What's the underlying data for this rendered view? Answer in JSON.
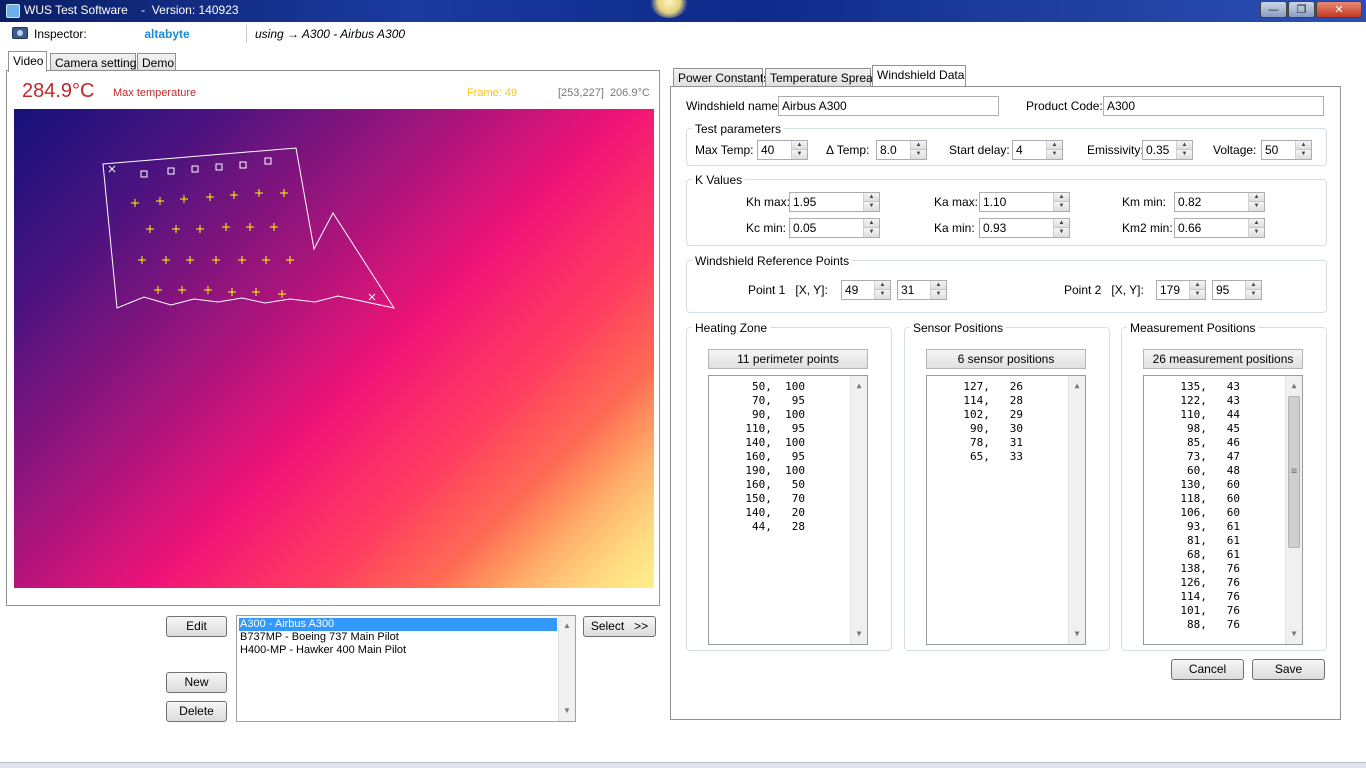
{
  "window": {
    "title": "WUS Test Software    -  Version: 140923",
    "minimize_glyph": "—",
    "maximize_glyph": "❐",
    "close_glyph": "✕"
  },
  "inspector": {
    "label": "Inspector:",
    "name": "altabyte",
    "using": "using → A300 - Airbus A300"
  },
  "left_tabs": [
    "Video",
    "Camera settings",
    "Demo"
  ],
  "video": {
    "max_temp": "284.9°C",
    "max_temp_label": "Max temperature",
    "frame": "Frame: 49",
    "cursor_coord": "[253,227]",
    "cursor_temp": "206.9°C"
  },
  "buttons": {
    "edit": "Edit",
    "new": "New",
    "delete": "Delete",
    "select": "Select   >>",
    "cancel": "Cancel",
    "save": "Save"
  },
  "windshield_list": [
    "A300 - Airbus A300",
    "B737MP - Boeing 737 Main Pilot",
    "H400-MP - Hawker 400 Main Pilot"
  ],
  "right_tabs": [
    "Power Constants",
    "Temperature Spread",
    "Windshield Data"
  ],
  "windshield": {
    "name_label": "Windshield name:",
    "name_value": "Airbus A300",
    "product_label": "Product Code:",
    "product_value": "A300"
  },
  "test_parameters": {
    "title": "Test parameters",
    "max_temp_label": "Max Temp:",
    "max_temp": "40",
    "delta_temp_label": "Δ Temp:",
    "delta_temp": "8.0",
    "start_delay_label": "Start delay:",
    "start_delay": "4",
    "emissivity_label": "Emissivity:",
    "emissivity": "0.35",
    "voltage_label": "Voltage:",
    "voltage": "50"
  },
  "k_values": {
    "title": "K Values",
    "kh_max_label": "Kh max:",
    "kh_max": "1.95",
    "ka_max_label": "Ka max:",
    "ka_max": "1.10",
    "km_min_label": "Km min:",
    "km_min": "0.82",
    "kc_min_label": "Kc min:",
    "kc_min": "0.05",
    "ka_min_label": "Ka min:",
    "ka_min": "0.93",
    "km2_min_label": "Km2 min:",
    "km2_min": "0.66"
  },
  "reference_points": {
    "title": "Windshield Reference Points",
    "point1_label": "Point 1   [X, Y]:",
    "point1_x": "49",
    "point1_y": "31",
    "point2_label": "Point 2   [X, Y]:",
    "point2_x": "179",
    "point2_y": "95"
  },
  "heating_zone": {
    "title": "Heating Zone",
    "header": "11 perimeter points",
    "points": [
      "50,  100",
      "70,   95",
      "90,  100",
      "110,   95",
      "140,  100",
      "160,   95",
      "190,  100",
      "160,   50",
      "150,   70",
      "140,   20",
      "44,   28"
    ]
  },
  "sensor_positions": {
    "title": "Sensor Positions",
    "header": "6 sensor positions",
    "points": [
      "127,   26",
      "114,   28",
      "102,   29",
      "90,   30",
      "78,   31",
      "65,   33"
    ]
  },
  "measurement_positions": {
    "title": "Measurement Positions",
    "header": "26 measurement positions",
    "points": [
      "135,   43",
      "122,   43",
      "110,   44",
      "98,   45",
      "85,   46",
      "73,   47",
      "60,   48",
      "130,   60",
      "118,   60",
      "106,   60",
      "93,   61",
      "81,   61",
      "68,   61",
      "138,   76",
      "126,   76",
      "114,   76",
      "101,   76",
      "88,   76"
    ]
  },
  "colors": {
    "max_temp": "#c0282a",
    "frame": "#f5c518",
    "inspector_name": "#1e88d8",
    "list_selection": "#3399ff",
    "overlay_marks": "#ffff00"
  }
}
